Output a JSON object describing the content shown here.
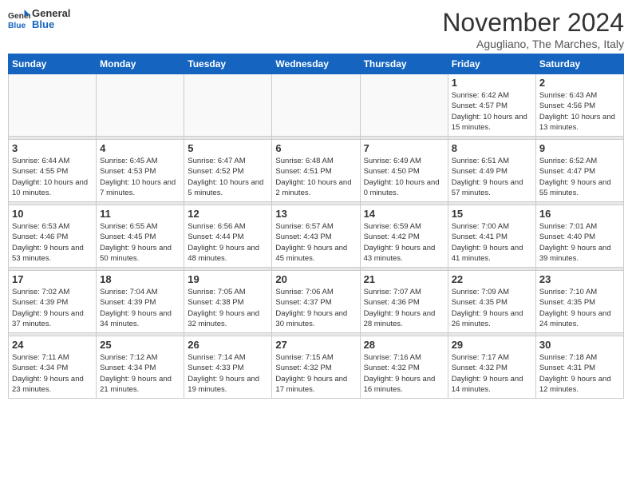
{
  "header": {
    "title": "November 2024",
    "location": "Agugliano, The Marches, Italy",
    "logo_general": "General",
    "logo_blue": "Blue"
  },
  "days_of_week": [
    "Sunday",
    "Monday",
    "Tuesday",
    "Wednesday",
    "Thursday",
    "Friday",
    "Saturday"
  ],
  "weeks": [
    [
      {
        "day": "",
        "info": ""
      },
      {
        "day": "",
        "info": ""
      },
      {
        "day": "",
        "info": ""
      },
      {
        "day": "",
        "info": ""
      },
      {
        "day": "",
        "info": ""
      },
      {
        "day": "1",
        "info": "Sunrise: 6:42 AM\nSunset: 4:57 PM\nDaylight: 10 hours and 15 minutes."
      },
      {
        "day": "2",
        "info": "Sunrise: 6:43 AM\nSunset: 4:56 PM\nDaylight: 10 hours and 13 minutes."
      }
    ],
    [
      {
        "day": "3",
        "info": "Sunrise: 6:44 AM\nSunset: 4:55 PM\nDaylight: 10 hours and 10 minutes."
      },
      {
        "day": "4",
        "info": "Sunrise: 6:45 AM\nSunset: 4:53 PM\nDaylight: 10 hours and 7 minutes."
      },
      {
        "day": "5",
        "info": "Sunrise: 6:47 AM\nSunset: 4:52 PM\nDaylight: 10 hours and 5 minutes."
      },
      {
        "day": "6",
        "info": "Sunrise: 6:48 AM\nSunset: 4:51 PM\nDaylight: 10 hours and 2 minutes."
      },
      {
        "day": "7",
        "info": "Sunrise: 6:49 AM\nSunset: 4:50 PM\nDaylight: 10 hours and 0 minutes."
      },
      {
        "day": "8",
        "info": "Sunrise: 6:51 AM\nSunset: 4:49 PM\nDaylight: 9 hours and 57 minutes."
      },
      {
        "day": "9",
        "info": "Sunrise: 6:52 AM\nSunset: 4:47 PM\nDaylight: 9 hours and 55 minutes."
      }
    ],
    [
      {
        "day": "10",
        "info": "Sunrise: 6:53 AM\nSunset: 4:46 PM\nDaylight: 9 hours and 53 minutes."
      },
      {
        "day": "11",
        "info": "Sunrise: 6:55 AM\nSunset: 4:45 PM\nDaylight: 9 hours and 50 minutes."
      },
      {
        "day": "12",
        "info": "Sunrise: 6:56 AM\nSunset: 4:44 PM\nDaylight: 9 hours and 48 minutes."
      },
      {
        "day": "13",
        "info": "Sunrise: 6:57 AM\nSunset: 4:43 PM\nDaylight: 9 hours and 45 minutes."
      },
      {
        "day": "14",
        "info": "Sunrise: 6:59 AM\nSunset: 4:42 PM\nDaylight: 9 hours and 43 minutes."
      },
      {
        "day": "15",
        "info": "Sunrise: 7:00 AM\nSunset: 4:41 PM\nDaylight: 9 hours and 41 minutes."
      },
      {
        "day": "16",
        "info": "Sunrise: 7:01 AM\nSunset: 4:40 PM\nDaylight: 9 hours and 39 minutes."
      }
    ],
    [
      {
        "day": "17",
        "info": "Sunrise: 7:02 AM\nSunset: 4:39 PM\nDaylight: 9 hours and 37 minutes."
      },
      {
        "day": "18",
        "info": "Sunrise: 7:04 AM\nSunset: 4:39 PM\nDaylight: 9 hours and 34 minutes."
      },
      {
        "day": "19",
        "info": "Sunrise: 7:05 AM\nSunset: 4:38 PM\nDaylight: 9 hours and 32 minutes."
      },
      {
        "day": "20",
        "info": "Sunrise: 7:06 AM\nSunset: 4:37 PM\nDaylight: 9 hours and 30 minutes."
      },
      {
        "day": "21",
        "info": "Sunrise: 7:07 AM\nSunset: 4:36 PM\nDaylight: 9 hours and 28 minutes."
      },
      {
        "day": "22",
        "info": "Sunrise: 7:09 AM\nSunset: 4:35 PM\nDaylight: 9 hours and 26 minutes."
      },
      {
        "day": "23",
        "info": "Sunrise: 7:10 AM\nSunset: 4:35 PM\nDaylight: 9 hours and 24 minutes."
      }
    ],
    [
      {
        "day": "24",
        "info": "Sunrise: 7:11 AM\nSunset: 4:34 PM\nDaylight: 9 hours and 23 minutes."
      },
      {
        "day": "25",
        "info": "Sunrise: 7:12 AM\nSunset: 4:34 PM\nDaylight: 9 hours and 21 minutes."
      },
      {
        "day": "26",
        "info": "Sunrise: 7:14 AM\nSunset: 4:33 PM\nDaylight: 9 hours and 19 minutes."
      },
      {
        "day": "27",
        "info": "Sunrise: 7:15 AM\nSunset: 4:32 PM\nDaylight: 9 hours and 17 minutes."
      },
      {
        "day": "28",
        "info": "Sunrise: 7:16 AM\nSunset: 4:32 PM\nDaylight: 9 hours and 16 minutes."
      },
      {
        "day": "29",
        "info": "Sunrise: 7:17 AM\nSunset: 4:32 PM\nDaylight: 9 hours and 14 minutes."
      },
      {
        "day": "30",
        "info": "Sunrise: 7:18 AM\nSunset: 4:31 PM\nDaylight: 9 hours and 12 minutes."
      }
    ]
  ]
}
